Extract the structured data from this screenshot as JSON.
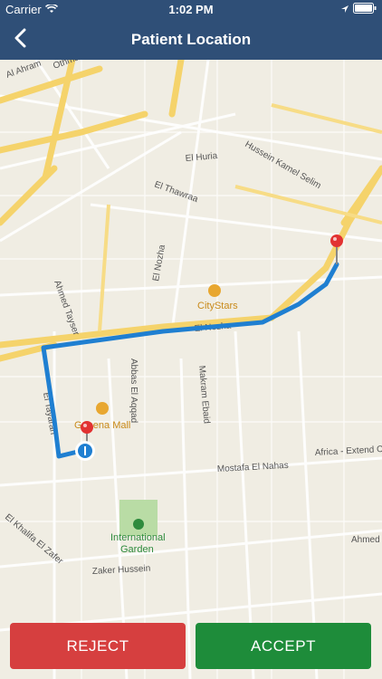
{
  "status": {
    "carrier": "Carrier",
    "time": "1:02 PM",
    "icons": [
      "wifi-icon",
      "location-arrow-icon",
      "battery-icon"
    ]
  },
  "nav": {
    "title": "Patient Location",
    "back_icon": "chevron-left-icon"
  },
  "map": {
    "streets": {
      "s1": "Al Ahram",
      "s2": "Othman Ibn Affan",
      "s3": "El Huria",
      "s4": "Hussein Kamel Selim",
      "s5": "El Thawraa",
      "s6": "El Nozha",
      "s7": "Ahmed Tayser",
      "s8": "El Nozha",
      "s9": "Abbas El Aqqad",
      "s10": "Makram Ebaid",
      "s11": "El Tayaran",
      "s12": "Mostafa El Nahas",
      "s13": "Africa - Extend C",
      "s14": "El Khalifa El Zafer",
      "s15": "Zaker Hussein",
      "s16": "Ahmed"
    },
    "pois": {
      "citystars": "CityStars",
      "genena": "Genena Mall",
      "garden_line1": "International",
      "garden_line2": "Garden"
    },
    "pins": [
      "destination-pin-icon",
      "origin-pin-icon",
      "current-location-icon"
    ],
    "colors": {
      "route": "#1f7fd1",
      "pin": "#e23232",
      "major_road": "#f5d36b"
    }
  },
  "actions": {
    "reject": "REJECT",
    "accept": "ACCEPT",
    "reject_color": "#d63f3f",
    "accept_color": "#1e8c3a"
  }
}
